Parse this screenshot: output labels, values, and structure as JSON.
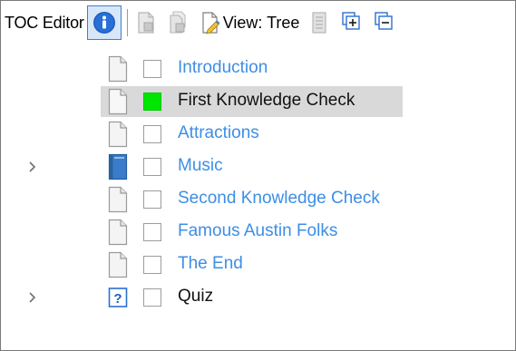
{
  "toolbar": {
    "title": "TOC Editor",
    "view_label": "View: Tree",
    "icons": [
      "info-icon",
      "page-grayed-icon",
      "pages-grayed-icon",
      "page-edit-icon",
      "notes-grayed-icon",
      "expand-all-icon",
      "collapse-all-icon"
    ]
  },
  "tree": {
    "items": [
      {
        "label": "Introduction",
        "icon": "page-icon",
        "checked": false,
        "expandable": false,
        "color": "#3d8ee6"
      },
      {
        "label": "First Knowledge Check",
        "icon": "page-icon",
        "checked": true,
        "expandable": false,
        "selected": true,
        "color": "#111111"
      },
      {
        "label": "Attractions",
        "icon": "page-icon",
        "checked": false,
        "expandable": false,
        "color": "#3d8ee6"
      },
      {
        "label": "Music",
        "icon": "book-icon",
        "checked": false,
        "expandable": true,
        "color": "#3d8ee6"
      },
      {
        "label": "Second Knowledge Check",
        "icon": "page-icon",
        "checked": false,
        "expandable": false,
        "color": "#3d8ee6"
      },
      {
        "label": "Famous Austin Folks",
        "icon": "page-icon",
        "checked": false,
        "expandable": false,
        "color": "#3d8ee6"
      },
      {
        "label": "The End",
        "icon": "page-icon",
        "checked": false,
        "expandable": false,
        "color": "#3d8ee6"
      },
      {
        "label": "Quiz",
        "icon": "quiz-icon",
        "checked": false,
        "expandable": true,
        "color": "#111111"
      }
    ]
  },
  "colors": {
    "link": "#3d8ee6",
    "checked": "#00e600",
    "selection": "#d9d9d9",
    "info_blue": "#1f5fbf"
  }
}
